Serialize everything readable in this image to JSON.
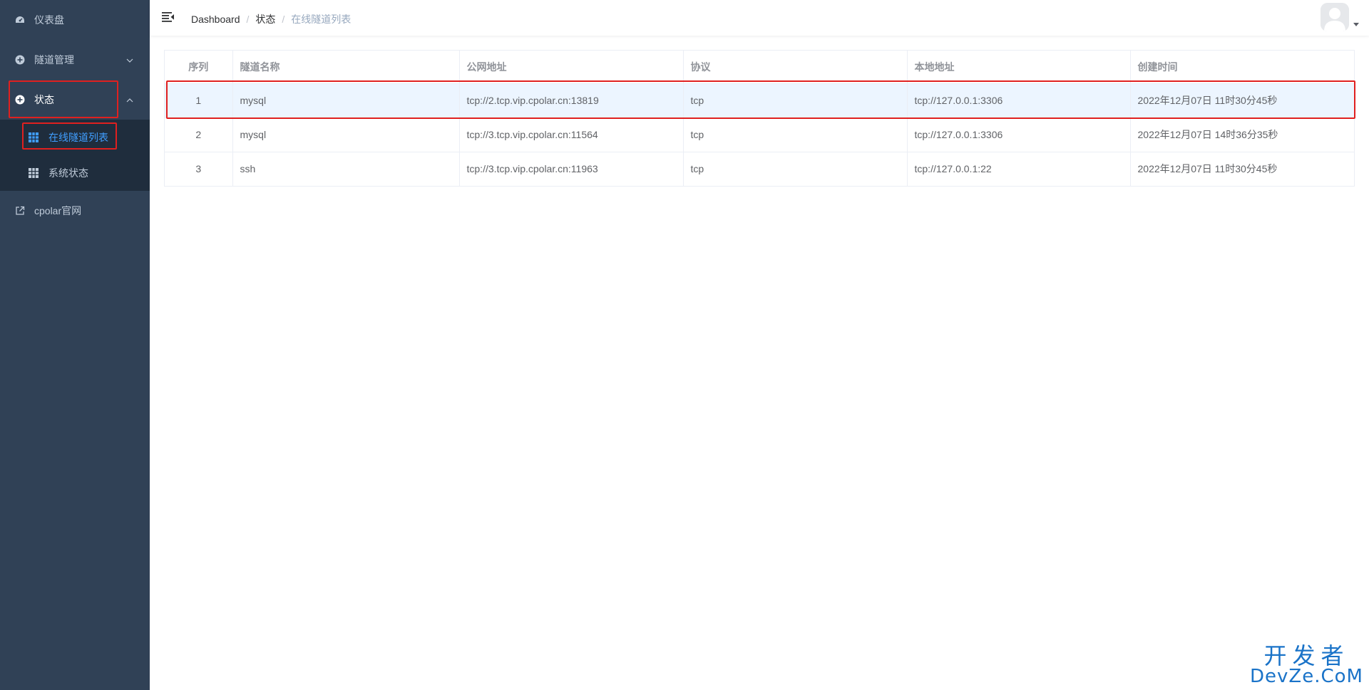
{
  "sidebar": {
    "items": [
      {
        "label": "仪表盘",
        "icon": "dashboard-icon"
      },
      {
        "label": "隧道管理",
        "icon": "plus-circle-icon",
        "expanded": false
      },
      {
        "label": "状态",
        "icon": "plus-circle-icon",
        "expanded": true,
        "children": [
          {
            "label": "在线隧道列表",
            "icon": "table-icon",
            "active": true
          },
          {
            "label": "系统状态",
            "icon": "table-icon",
            "active": false
          }
        ]
      },
      {
        "label": "cpolar官网",
        "icon": "external-link-icon"
      }
    ],
    "background": "#304156",
    "submenu_background": "#1f2d3d",
    "active_color": "#409eff"
  },
  "navbar": {
    "breadcrumb": [
      "Dashboard",
      "状态",
      "在线隧道列表"
    ]
  },
  "table": {
    "columns": [
      "序列",
      "隧道名称",
      "公网地址",
      "协议",
      "本地地址",
      "创建时间"
    ],
    "rows": [
      [
        "1",
        "mysql",
        "tcp://2.tcp.vip.cpolar.cn:13819",
        "tcp",
        "tcp://127.0.0.1:3306",
        "2022年12月07日 11时30分45秒"
      ],
      [
        "2",
        "mysql",
        "tcp://3.tcp.vip.cpolar.cn:11564",
        "tcp",
        "tcp://127.0.0.1:3306",
        "2022年12月07日 14时36分35秒"
      ],
      [
        "3",
        "ssh",
        "tcp://3.tcp.vip.cpolar.cn:11963",
        "tcp",
        "tcp://127.0.0.1:22",
        "2022年12月07日 11时30分45秒"
      ]
    ],
    "highlighted_row": 0
  },
  "watermark": {
    "top": "开发者",
    "bottom": "DevZe.CoM"
  },
  "annotation_color": "#e0201f"
}
